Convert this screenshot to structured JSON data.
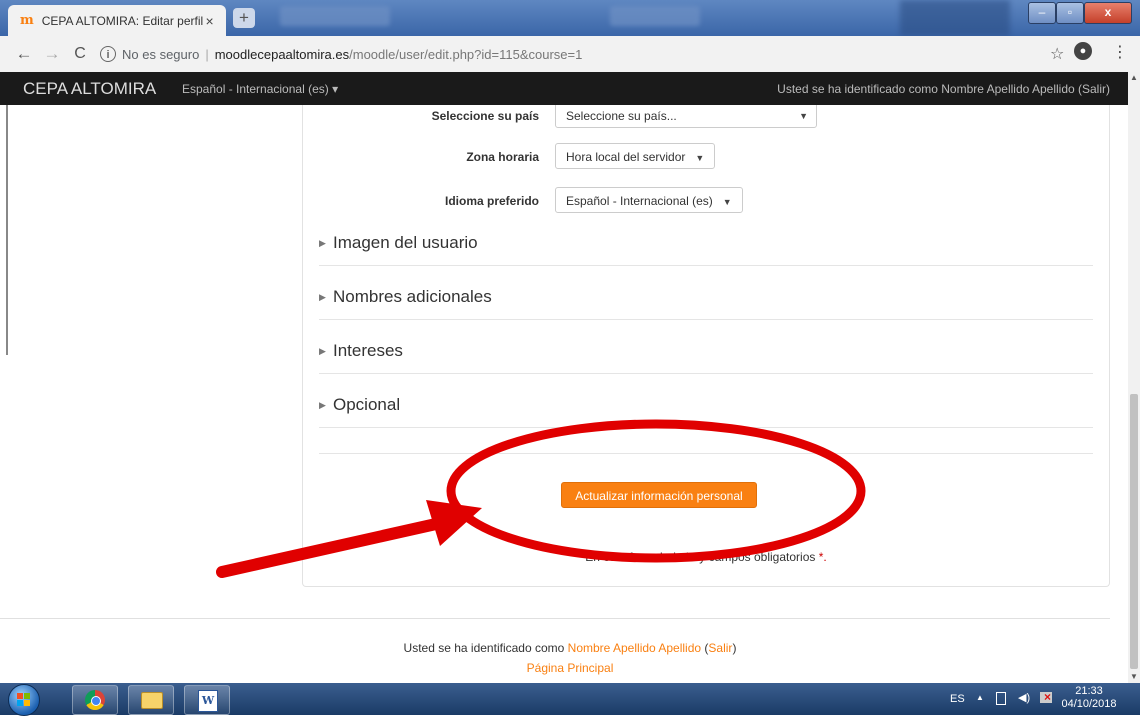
{
  "browser": {
    "tab_title": "CEPA ALTOMIRA: Editar perfil",
    "tab_close": "×",
    "new_tab": "+",
    "security": "No es seguro",
    "separator": "|",
    "url_host": "moodlecepaaltomira.es",
    "url_path": "/moodle/user/edit.php?id=115&course=1",
    "window_controls": {
      "minimize": "–",
      "maximize": "▫",
      "close": "x"
    }
  },
  "navbar": {
    "brand": "CEPA ALTOMIRA",
    "language": "Español - Internacional (es)",
    "user_info": "Usted se ha identificado como Nombre Apellido Apellido (Salir)"
  },
  "form": {
    "fields": [
      {
        "label": "Seleccione su país",
        "value": "Seleccione su país..."
      },
      {
        "label": "Zona horaria",
        "value": "Hora local del servidor"
      },
      {
        "label": "Idioma preferido",
        "value": "Español - Internacional (es)"
      }
    ],
    "sections": [
      "Imagen del usuario",
      "Nombres adicionales",
      "Intereses",
      "Opcional"
    ],
    "submit_label": "Actualizar información personal",
    "required_note": "En este formulario hay campos obligatorios",
    "required_star": "*."
  },
  "footer": {
    "logged_prefix": "Usted se ha identificado como",
    "user_name": "Nombre Apellido Apellido",
    "logout": "Salir",
    "home": "Página Principal"
  },
  "taskbar": {
    "language": "ES",
    "time": "21:33",
    "date": "04/10/2018"
  },
  "colors": {
    "moodle_orange": "#f98012",
    "navbar_bg": "#1a1a1a",
    "annotation_red": "#e00000"
  }
}
